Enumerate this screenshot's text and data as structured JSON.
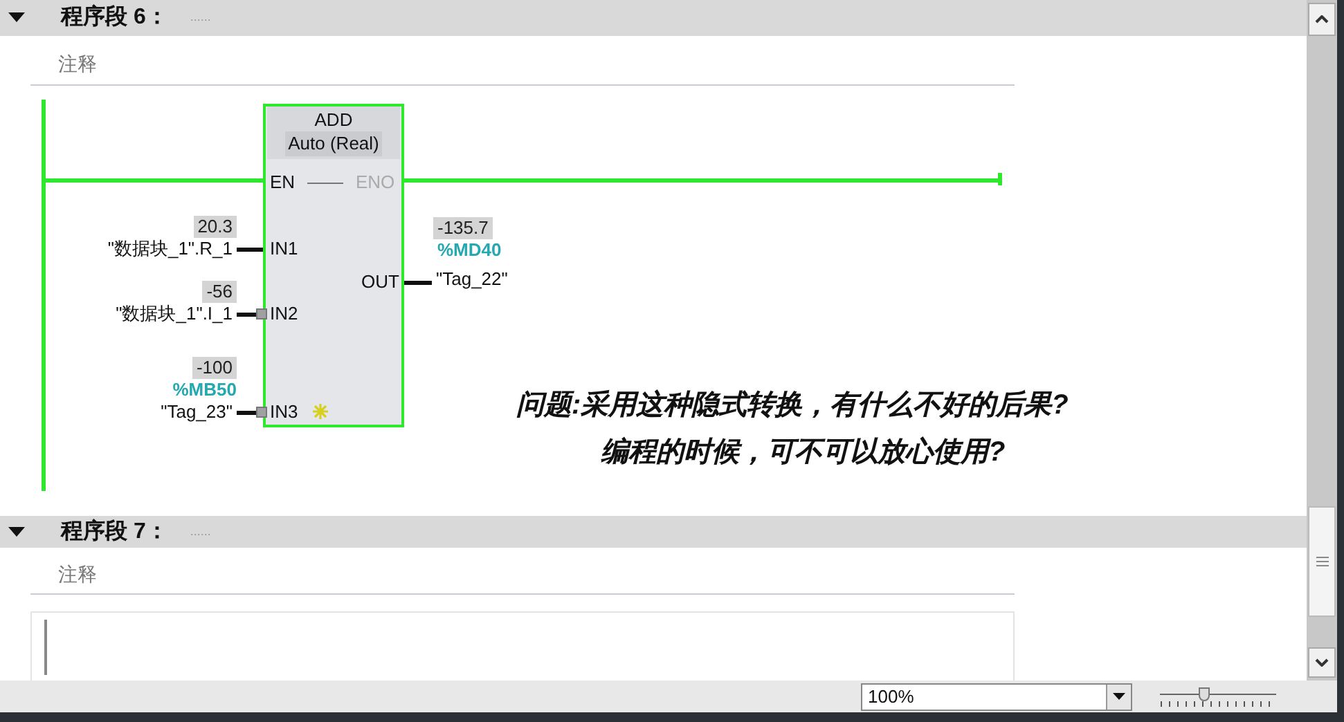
{
  "networks": [
    {
      "title": "程序段 6：",
      "comment_dots": "......",
      "expanded": true,
      "comment": "注释"
    },
    {
      "title": "程序段 7：",
      "comment_dots": "......",
      "expanded": true,
      "comment": "注释"
    }
  ],
  "block": {
    "name": "ADD",
    "type": "Auto (Real)",
    "en": "EN",
    "eno": "ENO",
    "inputs": [
      {
        "pin": "IN1",
        "value": "20.3",
        "operand": "\"数据块_1\".R_1",
        "converted": false
      },
      {
        "pin": "IN2",
        "value": "-56",
        "operand": "\"数据块_1\".I_1",
        "converted": true
      },
      {
        "pin": "IN3",
        "value": "-100",
        "address": "%MB50",
        "operand": "\"Tag_23\"",
        "converted": true
      }
    ],
    "output": {
      "pin": "OUT",
      "value": "-135.7",
      "address": "%MD40",
      "operand": "\"Tag_22\""
    }
  },
  "question": [
    "问题:采用这种隐式转换，有什么不好的后果?",
    "编程的时候，可不可以放心使用?"
  ],
  "status_bar": {
    "zoom": "100%",
    "zoom_slider": {
      "level": 0.37
    }
  }
}
